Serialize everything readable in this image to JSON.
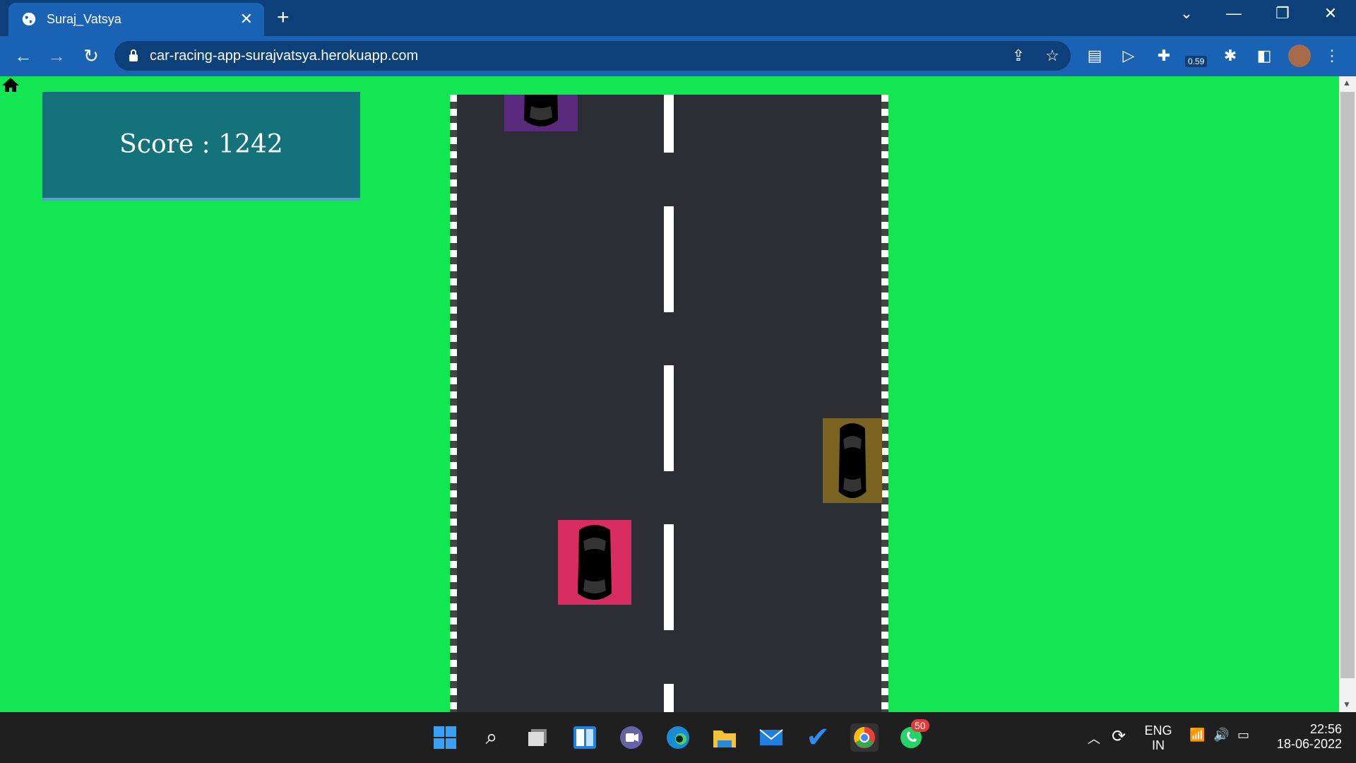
{
  "browser": {
    "tab_title": "Suraj_Vatsya",
    "url": "car-racing-app-surajvatsya.herokuapp.com",
    "extension_badge": "0.59"
  },
  "game": {
    "score_text": "Score : 1242",
    "colors": {
      "background": "#12e650",
      "road": "#2b2f33",
      "score_panel": "#13727a",
      "player_car": "#d82d62",
      "enemy_car_1": "#5a2a7e",
      "enemy_car_2": "#7a6422"
    },
    "cars": [
      {
        "role": "player",
        "lane": "left",
        "color_key": "player_car"
      },
      {
        "role": "enemy",
        "lane": "left",
        "color_key": "enemy_car_1"
      },
      {
        "role": "enemy",
        "lane": "right",
        "color_key": "enemy_car_2"
      }
    ]
  },
  "taskbar": {
    "language_top": "ENG",
    "language_bottom": "IN",
    "time": "22:56",
    "date": "18-06-2022",
    "whatsapp_badge": "50"
  }
}
